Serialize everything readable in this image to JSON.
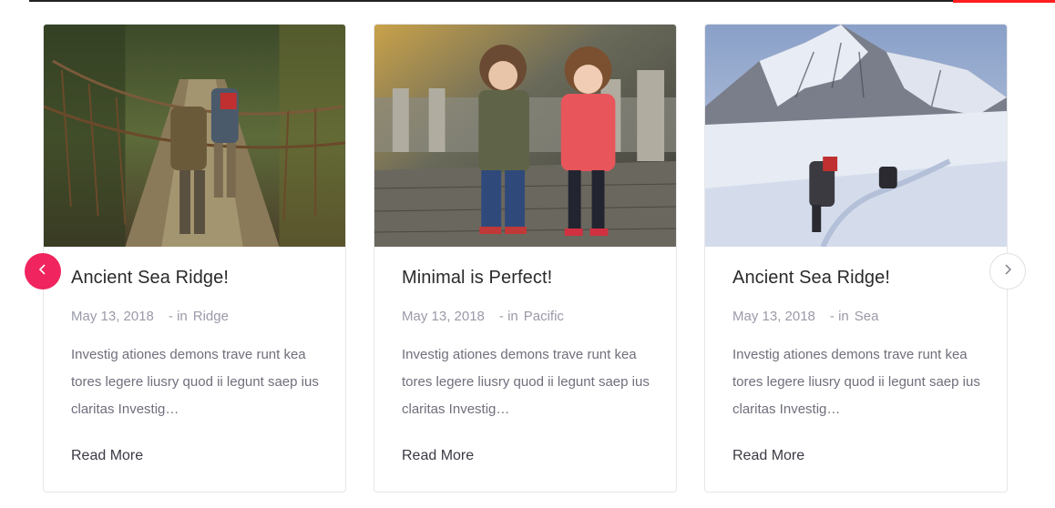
{
  "carousel": {
    "prev_icon": "chevron-left-icon",
    "next_icon": "chevron-right-icon",
    "accent_color": "#f0245e"
  },
  "posts": [
    {
      "title": "Ancient Sea Ridge!",
      "date": "May 13, 2018",
      "in_label": "- in",
      "category": "Ridge",
      "excerpt": "Investig ationes demons trave runt kea tores legere liusry quod ii legunt saep ius claritas Investig…",
      "read_more": "Read More",
      "image": "hikers-on-rope-bridge"
    },
    {
      "title": "Minimal is Perfect!",
      "date": "May 13, 2018",
      "in_label": "- in",
      "category": "Pacific",
      "excerpt": "Investig ationes demons trave runt kea tores legere liusry quod ii legunt saep ius claritas Investig…",
      "read_more": "Read More",
      "image": "two-children-on-path"
    },
    {
      "title": "Ancient Sea Ridge!",
      "date": "May 13, 2018",
      "in_label": "- in",
      "category": "Sea",
      "excerpt": "Investig ationes demons trave runt kea tores legere liusry quod ii legunt saep ius claritas Investig…",
      "read_more": "Read More",
      "image": "climbers-on-snowy-mountain"
    }
  ]
}
